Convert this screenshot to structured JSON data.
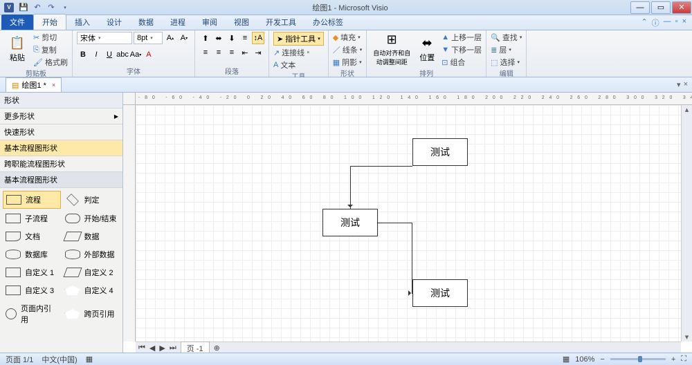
{
  "title": "绘图1 - Microsoft Visio",
  "qat_app": "V",
  "tabs": {
    "file": "文件",
    "home": "开始",
    "insert": "插入",
    "design": "设计",
    "data": "数据",
    "process": "进程",
    "review": "审阅",
    "view": "视图",
    "dev": "开发工具",
    "office": "办公标签"
  },
  "ribbon": {
    "clipboard": {
      "paste": "粘贴",
      "cut": "剪切",
      "copy": "复制",
      "format": "格式刷",
      "label": "剪贴板"
    },
    "font": {
      "family": "宋体",
      "size": "8pt",
      "label": "字体"
    },
    "para": {
      "label": "段落"
    },
    "tools": {
      "pointer": "指针工具",
      "connector": "连接线",
      "text": "文本",
      "label": "工具"
    },
    "shape": {
      "fill": "填充",
      "line": "线条",
      "shadow": "阴影",
      "label": "形状"
    },
    "arrange": {
      "auto": "自动对齐和自动调整间距",
      "pos": "位置",
      "bring": "上移一层",
      "send": "下移一层",
      "group": "组合",
      "label": "排列"
    },
    "edit": {
      "find": "查找",
      "layer": "层",
      "select": "选择",
      "label": "编辑"
    }
  },
  "doc_tab": "绘图1 *",
  "shapes": {
    "header": "形状",
    "more": "更多形状",
    "cats": [
      "快速形状",
      "基本流程图形状",
      "跨职能流程图形状"
    ],
    "section": "基本流程图形状",
    "items": [
      {
        "n": "流程",
        "t": "rect"
      },
      {
        "n": "判定",
        "t": "dia"
      },
      {
        "n": "子流程",
        "t": "rect"
      },
      {
        "n": "开始/结束",
        "t": "round"
      },
      {
        "n": "文档",
        "t": "doc"
      },
      {
        "n": "数据",
        "t": "par"
      },
      {
        "n": "数据库",
        "t": "cyl"
      },
      {
        "n": "外部数据",
        "t": "cyl"
      },
      {
        "n": "自定义 1",
        "t": "rect"
      },
      {
        "n": "自定义 2",
        "t": "par"
      },
      {
        "n": "自定义 3",
        "t": "rect"
      },
      {
        "n": "自定义 4",
        "t": "pent"
      },
      {
        "n": "页面内引用",
        "t": "circle"
      },
      {
        "n": "跨页引用",
        "t": "pent"
      }
    ]
  },
  "canvas": {
    "box1": "测试",
    "box2": "测试",
    "box3": "测试",
    "page_tab": "页 -1"
  },
  "status": {
    "page": "页面 1/1",
    "lang": "中文(中国)",
    "zoom": "106%"
  }
}
